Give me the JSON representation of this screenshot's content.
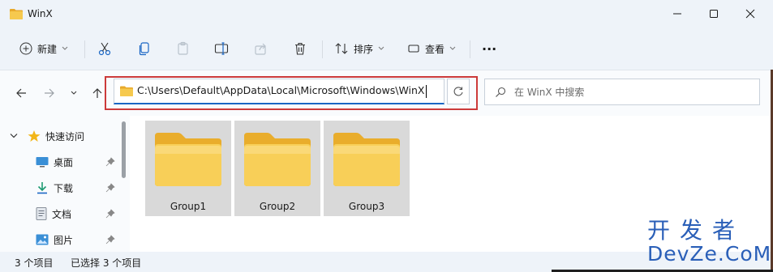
{
  "window": {
    "title": "WinX"
  },
  "toolbar": {
    "new_label": "新建",
    "sort_label": "排序",
    "view_label": "查看",
    "more_label": "···"
  },
  "nav": {
    "address": "C:\\Users\\Default\\AppData\\Local\\Microsoft\\Windows\\WinX",
    "search_placeholder": "在 WinX 中搜索"
  },
  "sidebar": {
    "items": [
      {
        "label": "快速访问",
        "icon": "star-icon"
      },
      {
        "label": "桌面",
        "icon": "desktop-icon"
      },
      {
        "label": "下载",
        "icon": "download-icon"
      },
      {
        "label": "文档",
        "icon": "document-icon"
      },
      {
        "label": "图片",
        "icon": "pictures-icon"
      }
    ]
  },
  "folders": [
    {
      "name": "Group1"
    },
    {
      "name": "Group2"
    },
    {
      "name": "Group3"
    }
  ],
  "status": {
    "count": "3 个项目",
    "selected": "已选择 3 个项目"
  },
  "watermark": {
    "cn": "开发者",
    "en": "DevZe.CoM"
  },
  "colors": {
    "accent": "#1a66c4",
    "folder": "#f6c94e",
    "highlight_border": "#cc3a3a",
    "watermark": "#2a5fb8"
  }
}
